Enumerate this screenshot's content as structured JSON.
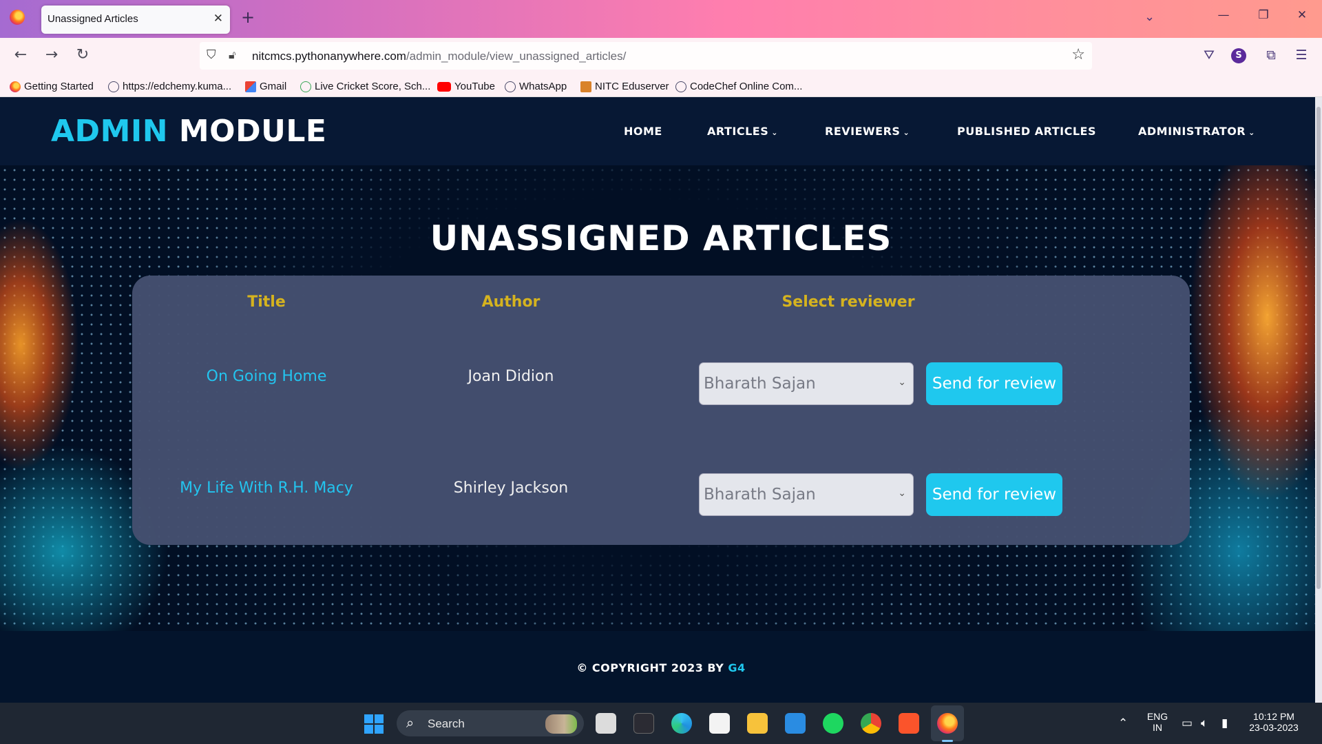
{
  "browser": {
    "tab_title": "Unassigned Articles",
    "tab_close": "✕",
    "new_tab": "+",
    "url_domain": "nitcmcs.pythonanywhere.com",
    "url_path": "/admin_module/view_unassigned_articles/",
    "profile_initial": "S",
    "bookmarks": [
      {
        "label": "Getting Started",
        "icon": "firefox-icon"
      },
      {
        "label": "https://edchemy.kuma...",
        "icon": "globe-icon"
      },
      {
        "label": "Gmail",
        "icon": "gmail-icon"
      },
      {
        "label": "Live Cricket Score, Sch...",
        "icon": "cricbuzz-icon"
      },
      {
        "label": "YouTube",
        "icon": "youtube-icon"
      },
      {
        "label": "WhatsApp",
        "icon": "globe-icon"
      },
      {
        "label": "NITC Eduserver",
        "icon": "nitc-icon"
      },
      {
        "label": "CodeChef Online Com...",
        "icon": "globe-icon"
      }
    ]
  },
  "site": {
    "brand_part1": "ADMIN",
    "brand_part2": "MODULE",
    "nav": [
      {
        "label": "HOME",
        "has_dropdown": false
      },
      {
        "label": "ARTICLES",
        "has_dropdown": true
      },
      {
        "label": "REVIEWERS",
        "has_dropdown": true
      },
      {
        "label": "PUBLISHED ARTICLES",
        "has_dropdown": false
      },
      {
        "label": "ADMINISTRATOR",
        "has_dropdown": true
      }
    ],
    "chevron": "⌄"
  },
  "main": {
    "heading": "UNASSIGNED ARTICLES",
    "columns": [
      "Title",
      "Author",
      "Select reviewer"
    ],
    "rows": [
      {
        "title": "On Going Home",
        "author": "Joan Didion",
        "reviewer": "Bharath Sajan",
        "action": "Send for review"
      },
      {
        "title": "My Life With R.H. Macy",
        "author": "Shirley Jackson",
        "reviewer": "Bharath Sajan",
        "action": "Send for review"
      }
    ]
  },
  "footer": {
    "copyright": "© COPYRIGHT 2023 BY ",
    "team": "G4"
  },
  "taskbar": {
    "search_label": "Search",
    "lang_top": "ENG",
    "lang_bottom": "IN",
    "time": "10:12 PM",
    "date": "23-03-2023"
  },
  "colors": {
    "accent": "#1fc8ee",
    "header_gold": "#d5b31f",
    "page_bg": "#020f24",
    "card_bg": "#445070"
  }
}
